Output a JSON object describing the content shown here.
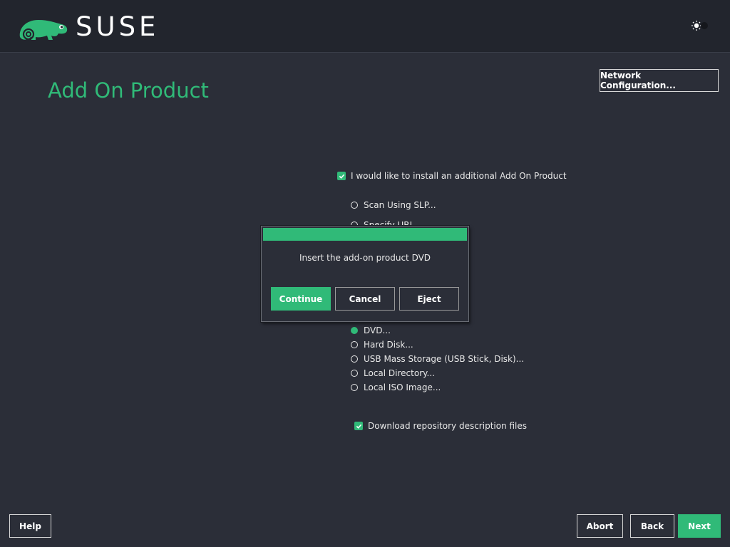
{
  "header": {
    "brand": "SUSE",
    "theme_toggle_icon": "sun-toggle-icon"
  },
  "page": {
    "title": "Add On Product",
    "network_config_label": "Network Configuration..."
  },
  "addon_checkbox": {
    "label": "I would like to install an additional Add On Product",
    "checked": true
  },
  "sources": [
    {
      "label": "Scan Using SLP...",
      "selected": false
    },
    {
      "label": "Specify URL...",
      "selected": false
    },
    {
      "label": "DVD...",
      "selected": true
    },
    {
      "label": "Hard Disk...",
      "selected": false
    },
    {
      "label": "USB Mass Storage (USB Stick, Disk)...",
      "selected": false
    },
    {
      "label": "Local Directory...",
      "selected": false
    },
    {
      "label": "Local ISO Image...",
      "selected": false
    }
  ],
  "download_checkbox": {
    "label": "Download repository description files",
    "checked": true
  },
  "dialog": {
    "message": "Insert the add-on product DVD",
    "continue_label": "Continue",
    "cancel_label": "Cancel",
    "eject_label": "Eject"
  },
  "footer": {
    "help_label": "Help",
    "abort_label": "Abort",
    "back_label": "Back",
    "next_label": "Next"
  },
  "colors": {
    "accent": "#30ba78",
    "background": "#2b2e38",
    "header_background": "#22252d"
  }
}
